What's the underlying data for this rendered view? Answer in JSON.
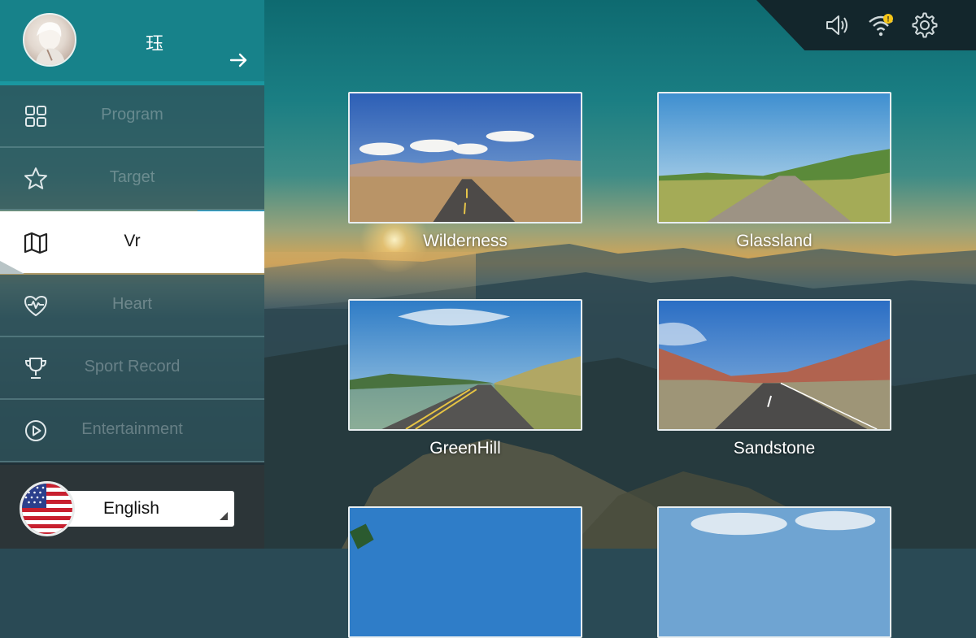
{
  "user": {
    "name": "珏"
  },
  "menu": [
    {
      "label": "Program",
      "icon": "grid-icon",
      "active": false
    },
    {
      "label": "Target",
      "icon": "star-icon",
      "active": false
    },
    {
      "label": "Vr",
      "icon": "map-icon",
      "active": true
    },
    {
      "label": "Heart",
      "icon": "heart-pulse-icon",
      "active": false
    },
    {
      "label": "Sport Record",
      "icon": "trophy-icon",
      "active": false
    },
    {
      "label": "Entertainment",
      "icon": "play-circle-icon",
      "active": false
    }
  ],
  "language": {
    "selected": "English",
    "flag": "us-flag-icon"
  },
  "status_icons": [
    "volume-icon",
    "wifi-icon",
    "settings-icon"
  ],
  "videos": [
    {
      "title": "Wilderness"
    },
    {
      "title": "Glassland"
    },
    {
      "title": "GreenHill"
    },
    {
      "title": "Sandstone"
    },
    {
      "title": ""
    },
    {
      "title": ""
    }
  ],
  "colors": {
    "accent": "#17828a",
    "active_tab": "#1aa8e0",
    "wifi_badge": "#f5c518"
  }
}
